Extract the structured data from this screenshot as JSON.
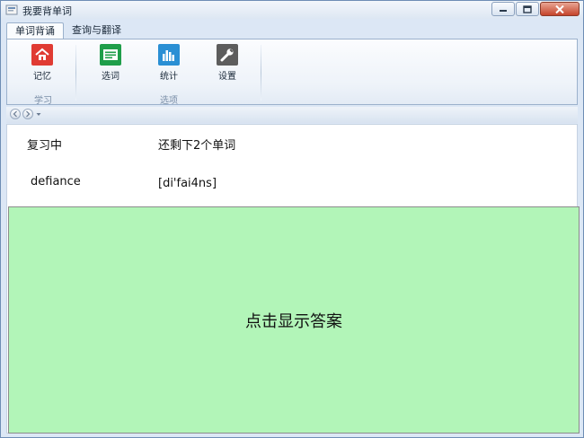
{
  "window": {
    "title": "我要背单词"
  },
  "ribbon": {
    "tabs": [
      {
        "label": "单词背诵",
        "active": true
      },
      {
        "label": "查询与翻译",
        "active": false
      }
    ],
    "groups": [
      {
        "label": "学习"
      },
      {
        "label": "选项"
      }
    ],
    "buttons": {
      "memorize": {
        "label": "记忆",
        "icon": "house-icon",
        "color": "#e03b33"
      },
      "select_words": {
        "label": "选词",
        "icon": "list-icon",
        "color": "#1f9e4a"
      },
      "statistics": {
        "label": "统计",
        "icon": "bar-chart-icon",
        "color": "#2a8fd4"
      },
      "settings": {
        "label": "设置",
        "icon": "wrench-icon",
        "color": "#5d5d5d"
      }
    }
  },
  "main": {
    "status_label": "复习中",
    "status_value": "还剩下2个单词",
    "word": "defiance",
    "phonetic": "[di'fai4ns]",
    "answer_prompt": "点击显示答案",
    "answer_bg": "#b2f5b8"
  }
}
